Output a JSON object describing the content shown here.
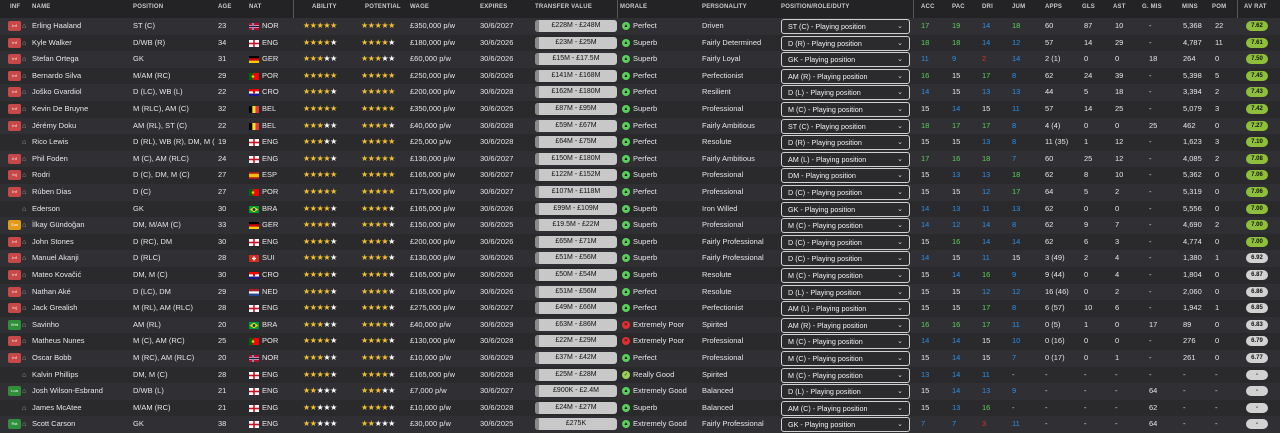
{
  "header": {
    "inf": "INF",
    "name": "NAME",
    "position": "POSITION",
    "age": "AGE",
    "nat": "NAT",
    "ability": "ABILITY",
    "potential": "POTENTIAL",
    "wage": "WAGE",
    "expires": "EXPIRES",
    "transfer_value": "TRANSFER VALUE",
    "morale": "MORALE",
    "personality": "PERSONALITY",
    "role": "POSITION/ROLE/DUTY",
    "acc": "ACC",
    "pac": "PAC",
    "dri": "DRI",
    "jum": "JUM",
    "apps": "APPS",
    "gls": "GLS",
    "ast": "AST",
    "gmis": "G. MIS",
    "mins": "MINS",
    "pom": "POM",
    "avrat": "AV RAT"
  },
  "colors": {
    "pos": "#5ad15a",
    "neg": "#e03030",
    "blue": "#2a8fe6",
    "ok": "#e8e8e8"
  },
  "players": [
    {
      "inf": "Inf",
      "inf_color": "#c84848",
      "name": "Erling Haaland",
      "pos": "ST (C)",
      "age": "23",
      "flag": "NOR",
      "nat": "NOR",
      "ab": 5,
      "pot": 5,
      "wage": "£350,000 p/w",
      "exp": "30/6/2027",
      "tv": "£228M - £248M",
      "mood": "up",
      "morale": "Perfect",
      "personality": "Driven",
      "role": "ST (C) - Playing position",
      "acc": "17",
      "pac": "19",
      "dri": "14",
      "jum": "18",
      "apps": "60",
      "gls": "87",
      "ast": "10",
      "gmis": "-",
      "mins": "5,368",
      "pom": "22",
      "avrat": "7.62",
      "avc": "#8fbf3a"
    },
    {
      "inf": "Inf",
      "inf_color": "#c84848",
      "name": "Kyle Walker",
      "pos": "D/WB (R)",
      "age": "34",
      "flag": "ENG",
      "nat": "ENG",
      "ab": 4,
      "pot": 4,
      "wage": "£180,000 p/w",
      "exp": "30/6/2026",
      "tv": "£23M - £25M",
      "mood": "up",
      "morale": "Superb",
      "personality": "Fairly Determined",
      "role": "D (R) - Playing position",
      "acc": "18",
      "pac": "18",
      "dri": "14",
      "jum": "12",
      "apps": "57",
      "gls": "14",
      "ast": "29",
      "gmis": "-",
      "mins": "4,787",
      "pom": "11",
      "avrat": "7.61",
      "avc": "#8fbf3a"
    },
    {
      "inf": "Inf",
      "inf_color": "#c84848",
      "name": "Stefan Ortega",
      "pos": "GK",
      "age": "31",
      "flag": "GER",
      "nat": "GER",
      "ab": 2.5,
      "pot": 2.5,
      "wage": "£60,000 p/w",
      "exp": "30/6/2026",
      "tv": "£15M - £17.5M",
      "mood": "up",
      "morale": "Superb",
      "personality": "Fairly Loyal",
      "role": "GK - Playing position",
      "acc": "11",
      "pac": "9",
      "dri": "2",
      "jum": "14",
      "apps": "2 (1)",
      "gls": "0",
      "ast": "0",
      "gmis": "18",
      "mins": "264",
      "pom": "0",
      "avrat": "7.50",
      "avc": "#8fbf3a"
    },
    {
      "inf": "Inf",
      "inf_color": "#c84848",
      "name": "Bernardo Silva",
      "pos": "M/AM (RC)",
      "age": "29",
      "flag": "POR",
      "nat": "POR",
      "ab": 5,
      "pot": 5,
      "wage": "£250,000 p/w",
      "exp": "30/6/2026",
      "tv": "£141M - £168M",
      "mood": "up",
      "morale": "Perfect",
      "personality": "Perfectionist",
      "role": "AM (R) - Playing position",
      "acc": "16",
      "pac": "15",
      "dri": "17",
      "jum": "8",
      "apps": "62",
      "gls": "24",
      "ast": "39",
      "gmis": "-",
      "mins": "5,398",
      "pom": "5",
      "avrat": "7.45",
      "avc": "#8fbf3a"
    },
    {
      "inf": "Inf",
      "inf_color": "#c84848",
      "name": "Joško Gvardiol",
      "pos": "D (LC), WB (L)",
      "age": "22",
      "flag": "CRO",
      "nat": "CRO",
      "ab": 4,
      "pot": 5,
      "wage": "£200,000 p/w",
      "exp": "30/6/2028",
      "tv": "£162M - £180M",
      "mood": "up",
      "morale": "Perfect",
      "personality": "Resilient",
      "role": "D (L) - Playing position",
      "acc": "14",
      "pac": "15",
      "dri": "13",
      "jum": "13",
      "apps": "44",
      "gls": "5",
      "ast": "18",
      "gmis": "-",
      "mins": "3,394",
      "pom": "2",
      "avrat": "7.43",
      "avc": "#8fbf3a"
    },
    {
      "inf": "Inf",
      "inf_color": "#c84848",
      "name": "Kevin De Bruyne",
      "pos": "M (RLC), AM (C)",
      "age": "32",
      "flag": "BEL",
      "nat": "BEL",
      "ab": 5,
      "pot": 5,
      "wage": "£350,000 p/w",
      "exp": "30/6/2025",
      "tv": "£87M - £95M",
      "mood": "up",
      "morale": "Superb",
      "personality": "Professional",
      "role": "M (C) - Playing position",
      "acc": "15",
      "pac": "14",
      "dri": "15",
      "jum": "11",
      "apps": "57",
      "gls": "14",
      "ast": "25",
      "gmis": "-",
      "mins": "5,079",
      "pom": "3",
      "avrat": "7.42",
      "avc": "#8fbf3a"
    },
    {
      "inf": "Inf",
      "inf_color": "#c84848",
      "name": "Jérémy Doku",
      "pos": "AM (RL), ST (C)",
      "age": "22",
      "flag": "BEL",
      "nat": "BEL",
      "ab": 3,
      "pot": 4,
      "wage": "£40,000 p/w",
      "exp": "30/6/2028",
      "tv": "£59M - £67M",
      "mood": "up",
      "morale": "Perfect",
      "personality": "Fairly Ambitious",
      "role": "ST (C) - Playing position",
      "acc": "18",
      "pac": "17",
      "dri": "17",
      "jum": "8",
      "apps": "4 (4)",
      "gls": "0",
      "ast": "0",
      "gmis": "25",
      "mins": "462",
      "pom": "0",
      "avrat": "7.27",
      "avc": "#8fbf3a"
    },
    {
      "inf": "",
      "inf_color": "",
      "name": "Rico Lewis",
      "pos": "D (RL), WB (R), DM, M (C)",
      "age": "19",
      "flag": "ENG",
      "nat": "ENG",
      "ab": 3,
      "pot": 4.5,
      "wage": "£25,000 p/w",
      "exp": "30/6/2028",
      "tv": "£64M - £75M",
      "mood": "up",
      "morale": "Perfect",
      "personality": "Resolute",
      "role": "D (R) - Playing position",
      "acc": "15",
      "pac": "15",
      "dri": "13",
      "jum": "8",
      "apps": "11 (35)",
      "gls": "1",
      "ast": "12",
      "gmis": "-",
      "mins": "1,623",
      "pom": "3",
      "avrat": "7.10",
      "avc": "#8fbf3a"
    },
    {
      "inf": "Inf",
      "inf_color": "#c84848",
      "name": "Phil Foden",
      "pos": "M (C), AM (RLC)",
      "age": "24",
      "flag": "ENG",
      "nat": "ENG",
      "ab": 4,
      "pot": 4.5,
      "wage": "£130,000 p/w",
      "exp": "30/6/2027",
      "tv": "£150M - £180M",
      "mood": "up",
      "morale": "Perfect",
      "personality": "Fairly Ambitious",
      "role": "AM (L) - Playing position",
      "acc": "17",
      "pac": "16",
      "dri": "18",
      "jum": "7",
      "apps": "60",
      "gls": "25",
      "ast": "12",
      "gmis": "-",
      "mins": "4,085",
      "pom": "2",
      "avrat": "7.08",
      "avc": "#8fbf3a"
    },
    {
      "inf": "Inj",
      "inf_color": "#c84848",
      "name": "Rodri",
      "pos": "D (C), DM, M (C)",
      "age": "27",
      "flag": "ESP",
      "nat": "ESP",
      "ab": 5,
      "pot": 5,
      "wage": "£165,000 p/w",
      "exp": "30/6/2027",
      "tv": "£122M - £152M",
      "mood": "up",
      "morale": "Superb",
      "personality": "Professional",
      "role": "DM - Playing position",
      "acc": "15",
      "pac": "13",
      "dri": "13",
      "jum": "18",
      "apps": "62",
      "gls": "8",
      "ast": "10",
      "gmis": "-",
      "mins": "5,362",
      "pom": "0",
      "avrat": "7.06",
      "avc": "#8fbf3a"
    },
    {
      "inf": "Inf",
      "inf_color": "#c84848",
      "name": "Rúben Dias",
      "pos": "D (C)",
      "age": "27",
      "flag": "POR",
      "nat": "POR",
      "ab": 5,
      "pot": 5,
      "wage": "£175,000 p/w",
      "exp": "30/6/2027",
      "tv": "£107M - £118M",
      "mood": "up",
      "morale": "Perfect",
      "personality": "Professional",
      "role": "D (C) - Playing position",
      "acc": "15",
      "pac": "15",
      "dri": "12",
      "jum": "17",
      "apps": "64",
      "gls": "5",
      "ast": "2",
      "gmis": "-",
      "mins": "5,319",
      "pom": "0",
      "avrat": "7.06",
      "avc": "#8fbf3a"
    },
    {
      "inf": "",
      "inf_color": "",
      "name": "Ederson",
      "pos": "GK",
      "age": "30",
      "flag": "BRA",
      "nat": "BRA",
      "ab": 4,
      "pot": 4,
      "wage": "£165,000 p/w",
      "exp": "30/6/2026",
      "tv": "£99M - £109M",
      "mood": "up",
      "morale": "Superb",
      "personality": "Iron Willed",
      "role": "GK - Playing position",
      "acc": "14",
      "pac": "13",
      "dri": "11",
      "jum": "13",
      "apps": "62",
      "gls": "0",
      "ast": "0",
      "gmis": "-",
      "mins": "5,556",
      "pom": "0",
      "avrat": "7.00",
      "avc": "#8fbf3a"
    },
    {
      "inf": "Sus",
      "inf_color": "#e39a1c",
      "name": "İlkay Gündoğan",
      "pos": "DM, M/AM (C)",
      "age": "33",
      "flag": "GER",
      "nat": "GER",
      "ab": 4,
      "pot": 4,
      "wage": "£150,000 p/w",
      "exp": "30/6/2025",
      "tv": "£19.5M - £22M",
      "mood": "up",
      "morale": "Superb",
      "personality": "Professional",
      "role": "M (C) - Playing position",
      "acc": "14",
      "pac": "12",
      "dri": "14",
      "jum": "8",
      "apps": "62",
      "gls": "9",
      "ast": "7",
      "gmis": "-",
      "mins": "4,690",
      "pom": "2",
      "avrat": "7.00",
      "avc": "#8fbf3a"
    },
    {
      "inf": "Inf",
      "inf_color": "#c84848",
      "name": "John Stones",
      "pos": "D (RC), DM",
      "age": "30",
      "flag": "ENG",
      "nat": "ENG",
      "ab": 4,
      "pot": 4,
      "wage": "£200,000 p/w",
      "exp": "30/6/2026",
      "tv": "£65M - £71M",
      "mood": "up",
      "morale": "Superb",
      "personality": "Fairly Professional",
      "role": "D (C) - Playing position",
      "acc": "15",
      "pac": "16",
      "dri": "14",
      "jum": "14",
      "apps": "62",
      "gls": "6",
      "ast": "3",
      "gmis": "-",
      "mins": "4,774",
      "pom": "0",
      "avrat": "7.00",
      "avc": "#8fbf3a"
    },
    {
      "inf": "Inf",
      "inf_color": "#c84848",
      "name": "Manuel Akanji",
      "pos": "D (RLC)",
      "age": "28",
      "flag": "SUI",
      "nat": "SUI",
      "ab": 4,
      "pot": 4,
      "wage": "£130,000 p/w",
      "exp": "30/6/2026",
      "tv": "£51M - £56M",
      "mood": "up",
      "morale": "Superb",
      "personality": "Fairly Professional",
      "role": "D (C) - Playing position",
      "acc": "14",
      "pac": "15",
      "dri": "11",
      "jum": "15",
      "apps": "3 (49)",
      "gls": "2",
      "ast": "4",
      "gmis": "-",
      "mins": "1,380",
      "pom": "1",
      "avrat": "6.92",
      "avc": "#d2d2d2"
    },
    {
      "inf": "Inf",
      "inf_color": "#c84848",
      "name": "Mateo Kovačić",
      "pos": "DM, M (C)",
      "age": "30",
      "flag": "CRO",
      "nat": "CRO",
      "ab": 4,
      "pot": 4,
      "wage": "£165,000 p/w",
      "exp": "30/6/2026",
      "tv": "£50M - £54M",
      "mood": "up",
      "morale": "Superb",
      "personality": "Resolute",
      "role": "M (C) - Playing position",
      "acc": "15",
      "pac": "14",
      "dri": "16",
      "jum": "9",
      "apps": "9 (44)",
      "gls": "0",
      "ast": "4",
      "gmis": "-",
      "mins": "1,804",
      "pom": "0",
      "avrat": "6.87",
      "avc": "#d2d2d2"
    },
    {
      "inf": "Inf",
      "inf_color": "#c84848",
      "name": "Nathan Aké",
      "pos": "D (LC), DM",
      "age": "29",
      "flag": "NED",
      "nat": "NED",
      "ab": 4,
      "pot": 4,
      "wage": "£165,000 p/w",
      "exp": "30/6/2026",
      "tv": "£51M - £56M",
      "mood": "up",
      "morale": "Perfect",
      "personality": "Resolute",
      "role": "D (L) - Playing position",
      "acc": "15",
      "pac": "15",
      "dri": "12",
      "jum": "12",
      "apps": "16 (46)",
      "gls": "0",
      "ast": "2",
      "gmis": "-",
      "mins": "2,060",
      "pom": "0",
      "avrat": "6.86",
      "avc": "#d2d2d2"
    },
    {
      "inf": "Inj",
      "inf_color": "#c84848",
      "name": "Jack Grealish",
      "pos": "M (RL), AM (RLC)",
      "age": "28",
      "flag": "ENG",
      "nat": "ENG",
      "ab": 4,
      "pot": 4,
      "wage": "£275,000 p/w",
      "exp": "30/6/2027",
      "tv": "£49M - £66M",
      "mood": "up",
      "morale": "Perfect",
      "personality": "Perfectionist",
      "role": "AM (L) - Playing position",
      "acc": "15",
      "pac": "15",
      "dri": "17",
      "jum": "8",
      "apps": "6 (57)",
      "gls": "10",
      "ast": "6",
      "gmis": "-",
      "mins": "1,942",
      "pom": "1",
      "avrat": "6.85",
      "avc": "#d2d2d2"
    },
    {
      "inf": "Wnt",
      "inf_color": "#2f8f3a",
      "name": "Savinho",
      "pos": "AM (RL)",
      "age": "20",
      "flag": "BRA",
      "nat": "BRA",
      "ab": 2.5,
      "pot": 4,
      "wage": "£40,000 p/w",
      "exp": "30/6/2029",
      "tv": "£63M - £86M",
      "mood": "down",
      "morale": "Extremely Poor",
      "personality": "Spirited",
      "role": "AM (R) - Playing position",
      "acc": "16",
      "pac": "16",
      "dri": "17",
      "jum": "11",
      "apps": "0 (5)",
      "gls": "1",
      "ast": "0",
      "gmis": "17",
      "mins": "89",
      "pom": "0",
      "avrat": "6.83",
      "avc": "#d2d2d2"
    },
    {
      "inf": "Inf",
      "inf_color": "#c84848",
      "name": "Matheus Nunes",
      "pos": "M (C), AM (RC)",
      "age": "25",
      "flag": "POR",
      "nat": "POR",
      "ab": 4,
      "pot": 4,
      "wage": "£130,000 p/w",
      "exp": "30/6/2028",
      "tv": "£22M - £29M",
      "mood": "down",
      "morale": "Extremely Poor",
      "personality": "Professional",
      "role": "M (C) - Playing position",
      "acc": "14",
      "pac": "14",
      "dri": "15",
      "jum": "10",
      "apps": "0 (16)",
      "gls": "0",
      "ast": "0",
      "gmis": "-",
      "mins": "276",
      "pom": "0",
      "avrat": "6.79",
      "avc": "#d2d2d2"
    },
    {
      "inf": "Inf",
      "inf_color": "#c84848",
      "name": "Oscar Bobb",
      "pos": "M (RC), AM (RLC)",
      "age": "20",
      "flag": "NOR",
      "nat": "NOR",
      "ab": 3,
      "pot": 3.5,
      "wage": "£10,000 p/w",
      "exp": "30/6/2029",
      "tv": "£37M - £42M",
      "mood": "up",
      "morale": "Perfect",
      "personality": "Professional",
      "role": "M (C) - Playing position",
      "acc": "15",
      "pac": "14",
      "dri": "15",
      "jum": "7",
      "apps": "0 (17)",
      "gls": "0",
      "ast": "1",
      "gmis": "-",
      "mins": "261",
      "pom": "0",
      "avrat": "6.77",
      "avc": "#d2d2d2"
    },
    {
      "inf": "",
      "inf_color": "",
      "name": "Kalvin Phillips",
      "pos": "DM, M (C)",
      "age": "28",
      "flag": "ENG",
      "nat": "ENG",
      "ab": 4,
      "pot": 4,
      "wage": "£165,000 p/w",
      "exp": "30/6/2028",
      "tv": "£25M - £28M",
      "mood": "ok",
      "morale": "Really Good",
      "personality": "Spirited",
      "role": "M (C) - Playing position",
      "acc": "13",
      "pac": "14",
      "dri": "11",
      "jum": "-",
      "apps": "-",
      "gls": "-",
      "ast": "-",
      "gmis": "-",
      "mins": "-",
      "pom": "-",
      "avrat": "-",
      "avc": "#d2d2d2"
    },
    {
      "inf": "Loa",
      "inf_color": "#2f8f3a",
      "name": "Josh Wilson-Esbrand",
      "pos": "D/WB (L)",
      "age": "21",
      "flag": "ENG",
      "nat": "ENG",
      "ab": 2,
      "pot": 3,
      "wage": "£7,000 p/w",
      "exp": "30/6/2027",
      "tv": "£900K - £2.4M",
      "mood": "up",
      "morale": "Extremely Good",
      "personality": "Balanced",
      "role": "D (L) - Playing position",
      "acc": "15",
      "pac": "14",
      "dri": "13",
      "jum": "9",
      "apps": "-",
      "gls": "-",
      "ast": "-",
      "gmis": "64",
      "mins": "-",
      "pom": "-",
      "avrat": "-",
      "avc": "#d2d2d2"
    },
    {
      "inf": "",
      "inf_color": "",
      "name": "James McAtee",
      "pos": "M/AM (RC)",
      "age": "21",
      "flag": "ENG",
      "nat": "ENG",
      "ab": 2,
      "pot": 3.5,
      "wage": "£10,000 p/w",
      "exp": "30/6/2028",
      "tv": "£24M - £27M",
      "mood": "up",
      "morale": "Superb",
      "personality": "Balanced",
      "role": "AM (C) - Playing position",
      "acc": "15",
      "pac": "13",
      "dri": "16",
      "jum": "-",
      "apps": "-",
      "gls": "-",
      "ast": "-",
      "gmis": "62",
      "mins": "-",
      "pom": "-",
      "avrat": "-",
      "avc": "#d2d2d2"
    },
    {
      "inf": "Rst",
      "inf_color": "#2f8f3a",
      "name": "Scott Carson",
      "pos": "GK",
      "age": "38",
      "flag": "ENG",
      "nat": "ENG",
      "ab": 1.5,
      "pot": 1.5,
      "wage": "£30,000 p/w",
      "exp": "30/6/2025",
      "tv": "£275K",
      "mood": "up",
      "morale": "Extremely Good",
      "personality": "Fairly Professional",
      "role": "GK - Playing position",
      "acc": "7",
      "pac": "7",
      "dri": "3",
      "jum": "11",
      "apps": "-",
      "gls": "-",
      "ast": "-",
      "gmis": "64",
      "mins": "-",
      "pom": "-",
      "avrat": "-",
      "avc": "#d2d2d2"
    }
  ]
}
